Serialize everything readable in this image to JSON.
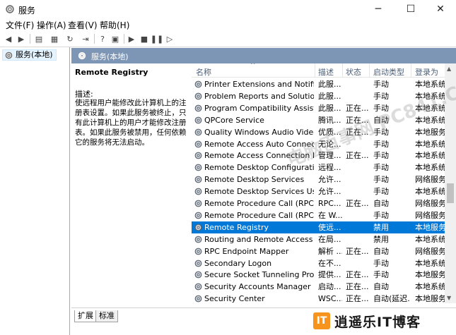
{
  "window": {
    "title": "服务"
  },
  "menu": {
    "items": [
      "文件(F)",
      "操作(A)",
      "查看(V)",
      "帮助(H)"
    ]
  },
  "tree": {
    "root": "服务(本地)"
  },
  "main": {
    "header": "服务(本地)"
  },
  "description": {
    "service_name": "Remote Registry",
    "label": "描述:",
    "text": "使远程用户能修改此计算机上的注册表设置。如果此服务被终止，只有此计算机上的用户才能修改注册表。如果此服务被禁用，任何依赖它的服务将无法启动。"
  },
  "table": {
    "columns": [
      "名称",
      "描述",
      "状态",
      "启动类型",
      "登录为"
    ],
    "rows": [
      {
        "name": "Printer Extensions and Notificat...",
        "desc": "此服...",
        "status": "",
        "startup": "手动",
        "logon": "本地系统"
      },
      {
        "name": "Problem Reports and Solutions...",
        "desc": "此服...",
        "status": "",
        "startup": "手动",
        "logon": "本地系统"
      },
      {
        "name": "Program Compatibility Assistan...",
        "desc": "此服...",
        "status": "正在...",
        "startup": "手动",
        "logon": "本地系统"
      },
      {
        "name": "QPCore Service",
        "desc": "腾讯...",
        "status": "正在...",
        "startup": "自动",
        "logon": "本地系统"
      },
      {
        "name": "Quality Windows Audio Video E...",
        "desc": "优质...",
        "status": "正在...",
        "startup": "手动",
        "logon": "本地服务"
      },
      {
        "name": "Remote Access Auto Connectio...",
        "desc": "无论...",
        "status": "",
        "startup": "手动",
        "logon": "本地系统"
      },
      {
        "name": "Remote Access Connection Ma...",
        "desc": "管理...",
        "status": "正在...",
        "startup": "手动",
        "logon": "本地系统"
      },
      {
        "name": "Remote Desktop Configuration",
        "desc": "远程...",
        "status": "",
        "startup": "手动",
        "logon": "本地系统"
      },
      {
        "name": "Remote Desktop Services",
        "desc": "允许...",
        "status": "",
        "startup": "手动",
        "logon": "网络服务"
      },
      {
        "name": "Remote Desktop Services User...",
        "desc": "允许...",
        "status": "",
        "startup": "手动",
        "logon": "本地系统"
      },
      {
        "name": "Remote Procedure Call (RPC)",
        "desc": "RPC...",
        "status": "正在...",
        "startup": "自动",
        "logon": "网络服务"
      },
      {
        "name": "Remote Procedure Call (RPC) L...",
        "desc": "在 W...",
        "status": "",
        "startup": "手动",
        "logon": "网络服务"
      },
      {
        "name": "Remote Registry",
        "desc": "使远...",
        "status": "",
        "startup": "禁用",
        "logon": "本地服务",
        "selected": true
      },
      {
        "name": "Routing and Remote Access",
        "desc": "在局...",
        "status": "",
        "startup": "禁用",
        "logon": "本地系统"
      },
      {
        "name": "RPC Endpoint Mapper",
        "desc": "解析 ...",
        "status": "正在...",
        "startup": "自动",
        "logon": "网络服务"
      },
      {
        "name": "Secondary Logon",
        "desc": "在不...",
        "status": "",
        "startup": "手动",
        "logon": "本地系统"
      },
      {
        "name": "Secure Socket Tunneling Protoc...",
        "desc": "提供...",
        "status": "正在...",
        "startup": "手动",
        "logon": "本地服务"
      },
      {
        "name": "Security Accounts Manager",
        "desc": "启动...",
        "status": "正在...",
        "startup": "自动",
        "logon": "本地系统"
      },
      {
        "name": "Security Center",
        "desc": "WSC...",
        "status": "正在...",
        "startup": "自动(延迟...",
        "logon": "本地服务"
      }
    ]
  },
  "tabs": {
    "extended": "扩展",
    "standard": "标准"
  },
  "watermark": {
    "text": "电脑百事网 PC841.COM"
  },
  "logo": {
    "mark": "IT",
    "text": "逍遥乐IT博客"
  },
  "colors": {
    "header_bg": "#7e96b5",
    "selection": "#0078d7",
    "logo_accent": "#f7941d"
  }
}
